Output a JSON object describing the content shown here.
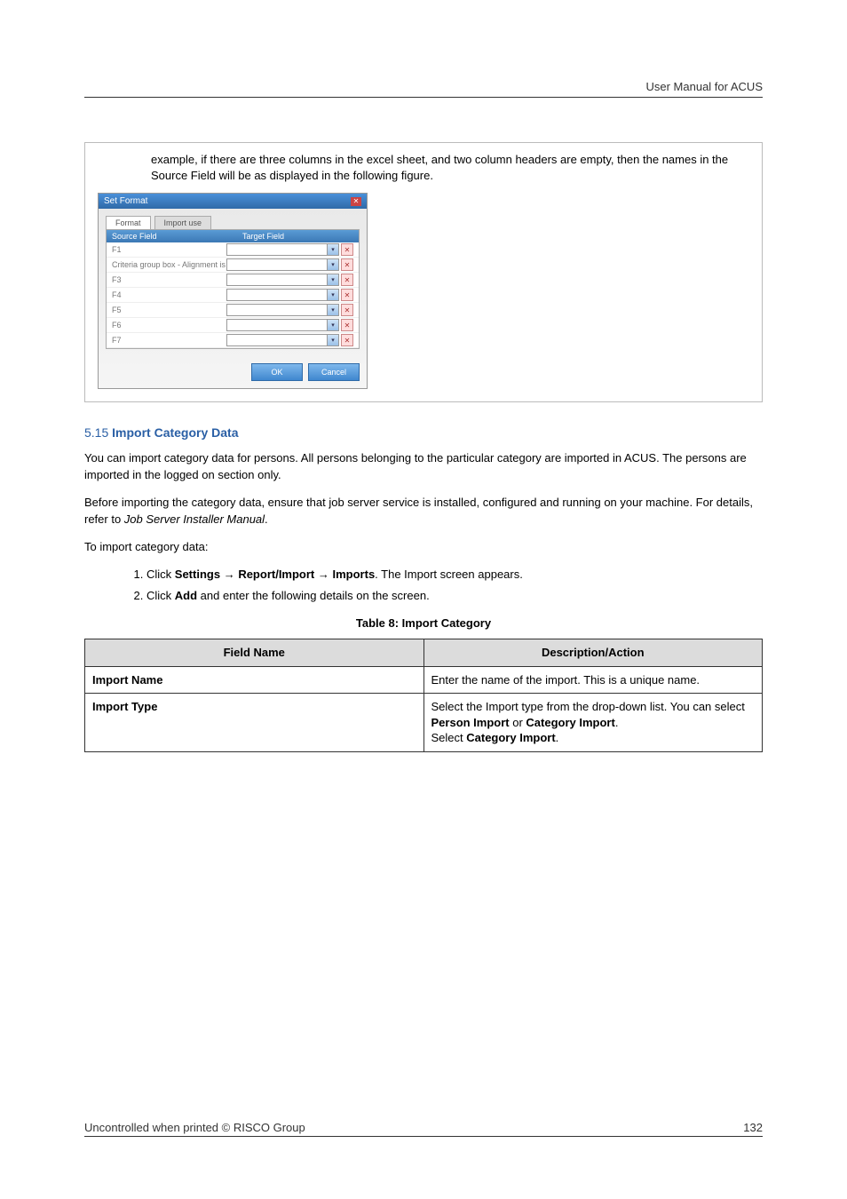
{
  "header": {
    "text": "User Manual for ACUS"
  },
  "example_block": {
    "text": "example, if there are three columns in the excel sheet, and two column headers are empty, then the names in the Source Field will be as displayed in the following figure."
  },
  "screenshot": {
    "title": "Set Format",
    "tab_active": "Format",
    "tab_inactive": "Import use",
    "col_source": "Source Field",
    "col_target": "Target Field",
    "rows": [
      "F1",
      "Criteria group box - Alignment is not p",
      "F3",
      "F4",
      "F5",
      "F6",
      "F7"
    ],
    "btn_ok": "OK",
    "btn_cancel": "Cancel"
  },
  "section": {
    "num": "5.15",
    "title": "Import Category Data"
  },
  "paragraphs": {
    "p1": "You can import category data for persons. All persons belonging to the particular category are imported in ACUS. The persons are imported in the logged on section only.",
    "p2a": "Before importing the category data, ensure that job server service is installed, configured and running on your machine. For details, refer to ",
    "p2_italic": "Job Server Installer Manual",
    "p2b": ".",
    "p3": "To import category data:"
  },
  "steps": {
    "s1a": "Click ",
    "s1b_bold": "Settings",
    "s1c": " → ",
    "s1d_bold": "Report/Import",
    "s1e": " → ",
    "s1f_bold": "Imports",
    "s1g": ". The Import screen appears.",
    "s2a": "Click ",
    "s2b_bold": "Add",
    "s2c": " and enter the following details on the screen."
  },
  "table": {
    "caption": "Table 8: Import Category",
    "head_field": "Field Name",
    "head_desc": "Description/Action",
    "rows": [
      {
        "field": "Import Name",
        "desc_plain": "Enter the name of the import. This is a unique name."
      },
      {
        "field": "Import Type",
        "desc_line1a": "Select the Import type from the drop-down list. You can select ",
        "desc_line1b_bold": "Person Import",
        "desc_line1c": " or ",
        "desc_line1d_bold": "Category Import",
        "desc_line1e": ".",
        "desc_line2a": "Select ",
        "desc_line2b_bold": "Category Import",
        "desc_line2c": "."
      }
    ]
  },
  "footer": {
    "left": "Uncontrolled when printed © RISCO Group",
    "right": "132"
  }
}
